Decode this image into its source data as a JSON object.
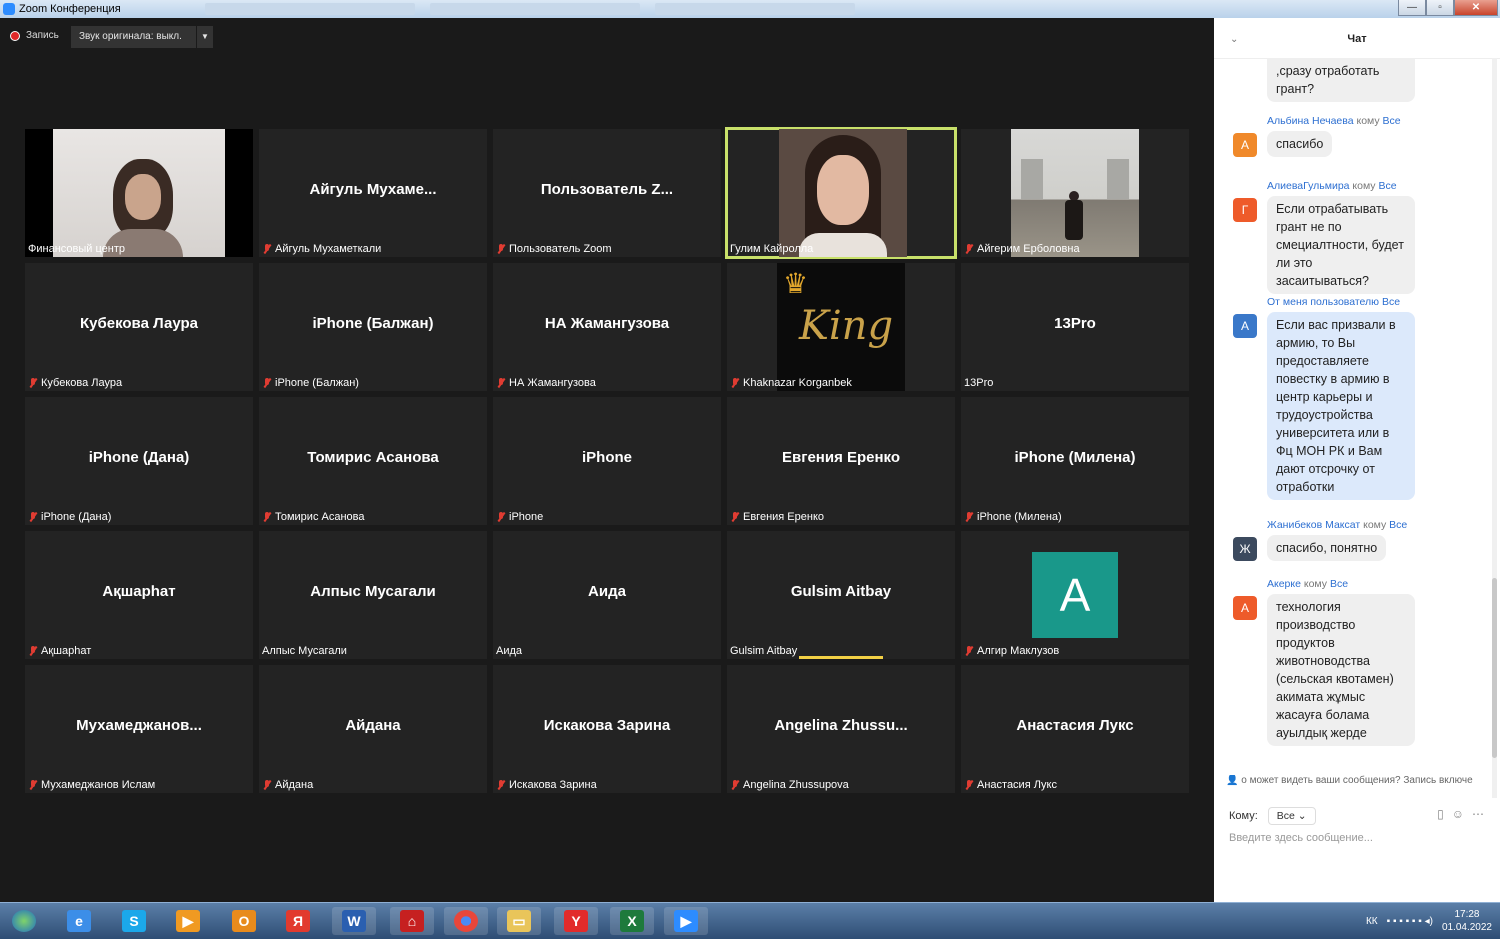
{
  "window": {
    "title": "Zoom Конференция"
  },
  "toolbar": {
    "record_label": "Запись",
    "original_sound": "Звук оригинала: выкл."
  },
  "tiles": [
    {
      "big": "",
      "label": "Финансовый центр",
      "muted": false,
      "video": "woman"
    },
    {
      "big": "Айгуль  Мухаме...",
      "label": "Айгуль Мухаметкали",
      "muted": true
    },
    {
      "big": "Пользователь  Z...",
      "label": "Пользователь Zoom",
      "muted": true
    },
    {
      "big": "",
      "label": "Гулим Кайролла",
      "muted": false,
      "video": "girl",
      "active": true
    },
    {
      "big": "",
      "label": "Айгерим Ерболовна",
      "muted": true,
      "video": "hall"
    },
    {
      "big": "Кубекова Лаура",
      "label": "Кубекова Лаура",
      "muted": true
    },
    {
      "big": "iPhone (Балжан)",
      "label": "iPhone (Балжан)",
      "muted": true
    },
    {
      "big": "НА Жамангузова",
      "label": "НА Жамангузова",
      "muted": true
    },
    {
      "big": "",
      "label": "Khaknazar Korganbek",
      "muted": true,
      "video": "king"
    },
    {
      "big": "13Pro",
      "label": "13Pro",
      "muted": false
    },
    {
      "big": "iPhone (Дана)",
      "label": "iPhone (Дана)",
      "muted": true
    },
    {
      "big": "Томирис Асанова",
      "label": "Томирис Асанова",
      "muted": true
    },
    {
      "big": "iPhone",
      "label": "iPhone",
      "muted": true
    },
    {
      "big": "Евгения Еренко",
      "label": "Евгения Еренко",
      "muted": true
    },
    {
      "big": "iPhone (Милена)",
      "label": "iPhone (Милена)",
      "muted": true
    },
    {
      "big": "Ақшарһат",
      "label": "Ақшарһат",
      "muted": true
    },
    {
      "big": "Алпыс Мусагали",
      "label": "Алпыс Мусагали",
      "muted": false
    },
    {
      "big": "Аида",
      "label": "Аида",
      "muted": false
    },
    {
      "big": "Gulsim Aitbay",
      "label": "Gulsim Aitbay",
      "muted": false,
      "speaking": true
    },
    {
      "big": "",
      "label": "Алгир Маклузов",
      "muted": true,
      "avatar": "A"
    },
    {
      "big": "Мухамеджанов...",
      "label": "Мухамеджанов Ислам",
      "muted": true
    },
    {
      "big": "Айдана",
      "label": "Айдана",
      "muted": true
    },
    {
      "big": "Искакова Зарина",
      "label": "Искакова Зарина",
      "muted": true
    },
    {
      "big": "Angelina  Zhussu...",
      "label": "Angelina Zhussupova",
      "muted": true
    },
    {
      "big": "Анастасия Лукс",
      "label": "Анастасия Лукс",
      "muted": true
    }
  ],
  "chat": {
    "title": "Чат",
    "messages": [
      {
        "sender": "",
        "to": "",
        "target": "",
        "avatar": "",
        "color": "",
        "text": ",сразу отработать грант?",
        "me": false
      },
      {
        "sender": "Альбина Нечаева",
        "to": "кому",
        "target": "Все",
        "avatar": "A",
        "color": "#f0892a",
        "text": "спасибо",
        "me": false
      },
      {
        "sender": "АлиеваГульмира",
        "to": "кому",
        "target": "Все",
        "avatar": "Г",
        "color": "#ee5b2a",
        "text": "Если отрабатывать грант не по смециалтности, будет ли это засаитываться?",
        "me": false
      },
      {
        "sender": "От меня пользователю",
        "to": "",
        "target": "Все",
        "avatar": "A",
        "color": "#3a78c9",
        "text": "Если вас призвали в армию, то Вы предоставляете повестку в армию в центр карьеры и трудоустройства университета или в Фц МОН РК и Вам дают отсрочку от отработки",
        "me": true
      },
      {
        "sender": "Жанибеков Максат",
        "to": "кому",
        "target": "Все",
        "avatar": "Ж",
        "color": "#3c4a5e",
        "text": "спасибо, понятно",
        "me": false
      },
      {
        "sender": "Акерке",
        "to": "кому",
        "target": "Все",
        "avatar": "A",
        "color": "#ee5b2a",
        "text": "технология производство продуктов животноводства (сельская квотамен) акимата жұмыс жасауға болама ауылдық жерде",
        "me": false
      }
    ],
    "privacy": "о может видеть ваши сообщения? Запись включе",
    "to_label": "Кому:",
    "to_value": "Все",
    "input_placeholder": "Введите здесь сообщение..."
  },
  "taskbar": {
    "lang": "КК",
    "time": "17:28",
    "date": "01.04.2022",
    "apps": [
      "start",
      "ie",
      "skype",
      "media",
      "outlook",
      "yandex-browser",
      "word",
      "pdf",
      "chrome",
      "explorer",
      "yandex",
      "excel",
      "zoom"
    ]
  }
}
